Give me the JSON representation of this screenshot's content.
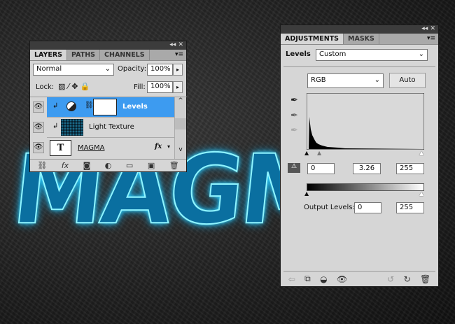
{
  "canvas": {
    "text": "MAGMA"
  },
  "layers_panel": {
    "tabs": [
      "LAYERS",
      "PATHS",
      "CHANNELS"
    ],
    "blend_mode": "Normal",
    "opacity_label": "Opacity:",
    "opacity": "100%",
    "lock_label": "Lock:",
    "fill_label": "Fill:",
    "fill": "100%",
    "layers": [
      {
        "name": "Levels",
        "selected": true
      },
      {
        "name": "Light Texture"
      },
      {
        "name": "MAGMA",
        "fx": "fx"
      }
    ]
  },
  "adjustments_panel": {
    "tabs": [
      "ADJUSTMENTS",
      "MASKS"
    ],
    "adjustment": "Levels",
    "preset": "Custom",
    "channel": "RGB",
    "auto_label": "Auto",
    "input_black": "0",
    "input_gamma": "3.26",
    "input_white": "255",
    "output_label": "Output Levels:",
    "output_black": "0",
    "output_white": "255"
  },
  "colors": {
    "selection": "#3d9bf0"
  }
}
